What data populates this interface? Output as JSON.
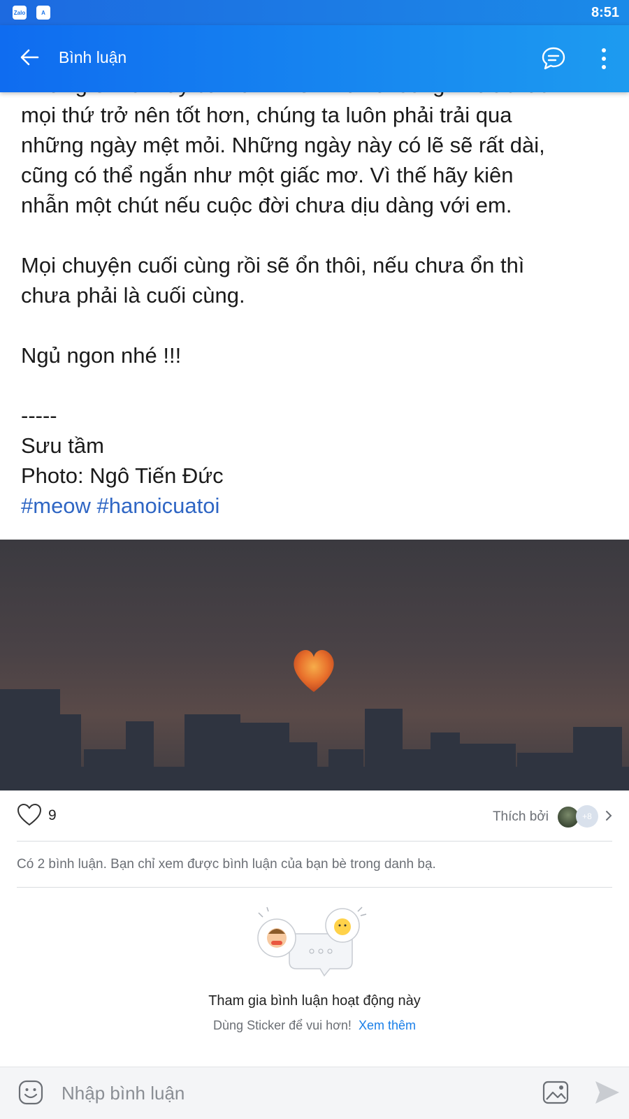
{
  "status_bar": {
    "time": "8:51",
    "app_icons": [
      "zalo-icon",
      "a-icon"
    ],
    "zalo_label": "Zalo",
    "a_label": "A"
  },
  "header": {
    "title": "Bình luận",
    "back_icon": "arrow-left-icon",
    "message_icon": "chat-bubble-icon",
    "more_icon": "more-vertical-icon"
  },
  "post": {
    "lines_top": [
      "Nhưng em ơi hãy cứ hồn nhiên mà vui sống. Trước lúc",
      "mọi thứ trở nên tốt hơn, chúng ta luôn phải trải qua",
      "những ngày mệt mỏi. Những ngày này có lẽ sẽ rất dài,",
      "cũng có thể ngắn như một giấc mơ. Vì thế hãy kiên",
      "nhẫn một chút nếu cuộc đời chưa dịu dàng với em."
    ],
    "paragraph2": [
      "Mọi chuyện cuối cùng rồi sẽ ổn thôi, nếu chưa ổn thì",
      "chưa phải là cuối cùng."
    ],
    "goodnight": "Ngủ ngon nhé !!!",
    "separator": "-----",
    "credit": "Sưu tầm",
    "photo_credit": "Photo: Ngô Tiến Đức",
    "hashtags": "#meow #hanoicuatoi"
  },
  "reactions": {
    "like_count": "9",
    "liked_by_label": "Thích bởi",
    "more_count": "+8"
  },
  "comments": {
    "note": "Có 2 bình luận. Bạn chỉ xem được bình luận của bạn bè trong danh bạ.",
    "join_title": "Tham gia bình luận hoạt động này",
    "join_subtitle": "Dùng Sticker để vui hơn!",
    "see_more": "Xem thêm"
  },
  "input": {
    "placeholder": "Nhập bình luận"
  },
  "colors": {
    "header": "#1d8cf0",
    "hashtag": "#2f66c4",
    "link": "#1a7fe8"
  }
}
